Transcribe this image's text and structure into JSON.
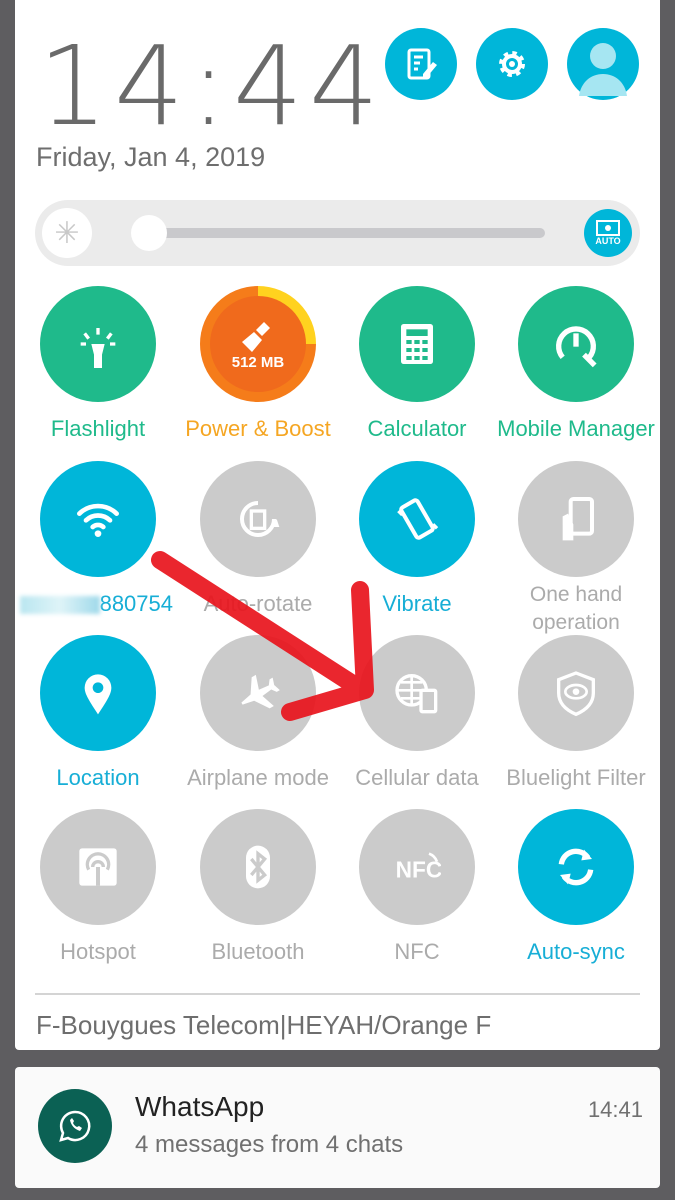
{
  "header": {
    "time": "14:44",
    "date": "Friday, Jan 4, 2019",
    "buttons": [
      {
        "icon": "edit-notes-icon"
      },
      {
        "icon": "gear-icon"
      },
      {
        "icon": "user-avatar-icon"
      }
    ]
  },
  "brightness": {
    "level": 0.05,
    "auto_label": "AUTO"
  },
  "tiles": [
    {
      "label": "Flashlight",
      "state": "on",
      "icon": "flashlight-icon"
    },
    {
      "label": "Power & Boost",
      "state": "on",
      "icon": "broom-icon",
      "badge": "512 MB"
    },
    {
      "label": "Calculator",
      "state": "on",
      "icon": "calculator-icon"
    },
    {
      "label": "Mobile Manager",
      "state": "on",
      "icon": "speedometer-wrench-icon"
    },
    {
      "label": "880754",
      "state": "on",
      "icon": "wifi-icon"
    },
    {
      "label": "Auto-rotate",
      "state": "off",
      "icon": "rotate-icon"
    },
    {
      "label": "Vibrate",
      "state": "on",
      "icon": "vibrate-icon"
    },
    {
      "label": "One hand operation",
      "state": "off",
      "icon": "one-hand-icon"
    },
    {
      "label": "Location",
      "state": "on",
      "icon": "location-pin-icon"
    },
    {
      "label": "Airplane mode",
      "state": "off",
      "icon": "airplane-icon"
    },
    {
      "label": "Cellular data",
      "state": "off",
      "icon": "globe-phone-icon"
    },
    {
      "label": "Bluelight Filter",
      "state": "off",
      "icon": "eye-shield-icon"
    },
    {
      "label": "Hotspot",
      "state": "off",
      "icon": "hotspot-icon"
    },
    {
      "label": "Bluetooth",
      "state": "off",
      "icon": "bluetooth-icon"
    },
    {
      "label": "NFC",
      "state": "off",
      "icon": "nfc-icon"
    },
    {
      "label": "Auto-sync",
      "state": "on",
      "icon": "sync-icon"
    }
  ],
  "carrier": "F-Bouygues Telecom|HEYAH/Orange F",
  "notification": {
    "app": "WhatsApp",
    "text": "4 messages from 4 chats",
    "time": "14:41"
  },
  "colors": {
    "accent": "#00b6d9",
    "green": "#1fba8b",
    "orange": "#f5a623",
    "inactive": "#cbcbcb",
    "annotation_arrow": "#e8141c"
  }
}
